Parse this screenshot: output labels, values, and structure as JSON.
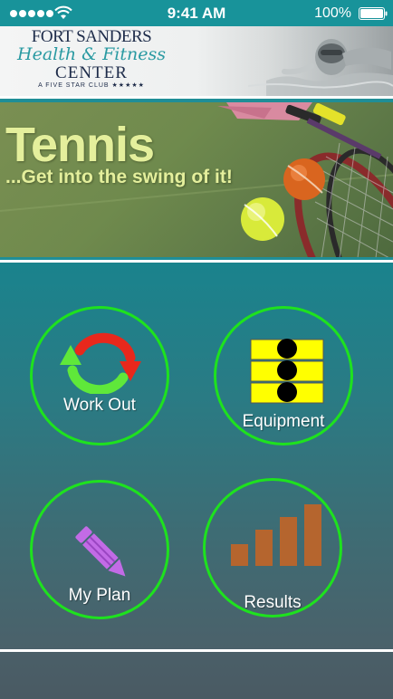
{
  "status_bar": {
    "time": "9:41 AM",
    "battery_percent": "100%",
    "signal_bars": 5,
    "icons": [
      "signal-icon",
      "wifi-icon",
      "battery-icon"
    ]
  },
  "header": {
    "logo": {
      "line1": "FORT SANDERS",
      "line2": "Health & Fitness",
      "line3": "CENTER",
      "line4": "A FIVE STAR CLUB ★★★★★"
    }
  },
  "banner": {
    "title": "Tennis",
    "subtitle": "...Get into the swing of it!"
  },
  "menu": {
    "items": [
      {
        "label": "Work Out",
        "icon": "cycle-arrows-icon"
      },
      {
        "label": "Equipment",
        "icon": "weight-stack-icon"
      },
      {
        "label": "My Plan",
        "icon": "pencil-icon"
      },
      {
        "label": "Results",
        "icon": "bar-chart-icon"
      }
    ]
  },
  "colors": {
    "status_bar": "#18939a",
    "button_ring": "#1ee21e",
    "cycle_red": "#e8281c",
    "cycle_green": "#5fe83a",
    "equipment_yellow": "#ffff00",
    "pencil_purple": "#c26be6",
    "results_bars": "#b5652e",
    "banner_text": "#e4ef9c"
  }
}
